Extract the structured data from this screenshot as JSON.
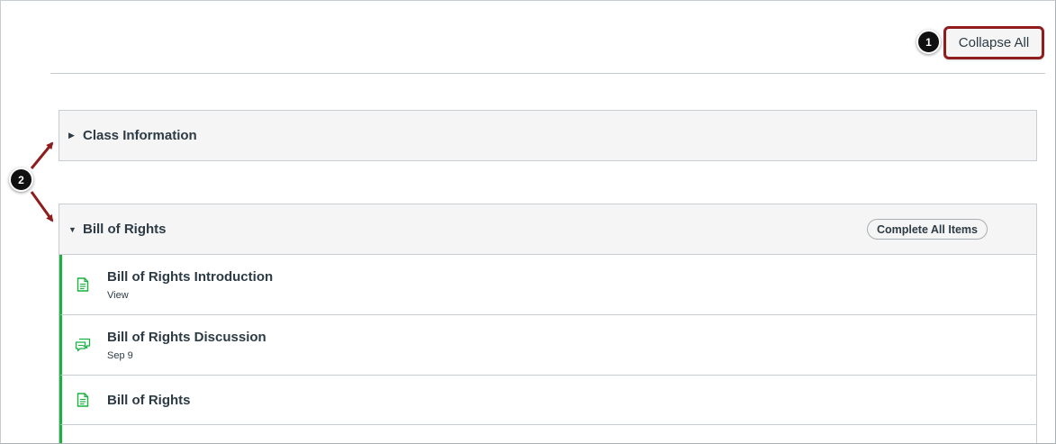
{
  "toolbar": {
    "collapse_all_label": "Collapse All"
  },
  "callouts": {
    "one": "1",
    "two": "2"
  },
  "modules": [
    {
      "title": "Class Information",
      "expanded": false,
      "caret_icon": "caret-right-icon"
    },
    {
      "title": "Bill of Rights",
      "expanded": true,
      "caret_icon": "caret-down-icon",
      "complete_all_label": "Complete All Items",
      "items": [
        {
          "title": "Bill of Rights Introduction",
          "meta": "View",
          "icon": "page-icon"
        },
        {
          "title": "Bill of Rights Discussion",
          "meta": "Sep 9",
          "icon": "discussion-icon"
        },
        {
          "title": "Bill of Rights",
          "meta": "",
          "icon": "page-icon"
        }
      ]
    }
  ],
  "colors": {
    "callout_red": "#8f1d1d",
    "published_green": "#1ab240",
    "header_gray": "#f5f5f5",
    "text_dark": "#2d3b45"
  }
}
